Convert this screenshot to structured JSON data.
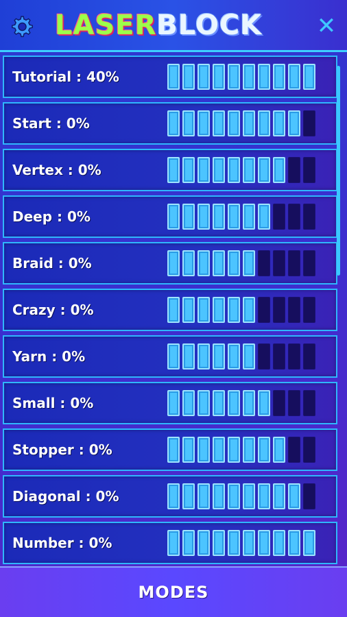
{
  "header": {
    "title_part1": "LASER",
    "title_part2": "BLOCK",
    "settings_icon": "gear-icon",
    "close_icon": "close-icon",
    "close_glyph": "✕"
  },
  "colors": {
    "accent": "#3ed0ff",
    "segment_on": "#4cc4ff",
    "segment_off": "#160e5e",
    "title_green": "#9cff4a"
  },
  "levels": [
    {
      "label": "Tutorial : 40%",
      "filled": 10,
      "total": 10
    },
    {
      "label": "Start : 0%",
      "filled": 9,
      "total": 10
    },
    {
      "label": "Vertex : 0%",
      "filled": 8,
      "total": 10
    },
    {
      "label": "Deep : 0%",
      "filled": 7,
      "total": 10
    },
    {
      "label": "Braid : 0%",
      "filled": 6,
      "total": 10
    },
    {
      "label": "Crazy : 0%",
      "filled": 6,
      "total": 10
    },
    {
      "label": "Yarn : 0%",
      "filled": 6,
      "total": 10
    },
    {
      "label": "Small : 0%",
      "filled": 7,
      "total": 10
    },
    {
      "label": "Stopper : 0%",
      "filled": 8,
      "total": 10
    },
    {
      "label": "Diagonal : 0%",
      "filled": 9,
      "total": 10
    },
    {
      "label": "Number : 0%",
      "filled": 10,
      "total": 10
    }
  ],
  "footer": {
    "modes_label": "MODES"
  }
}
